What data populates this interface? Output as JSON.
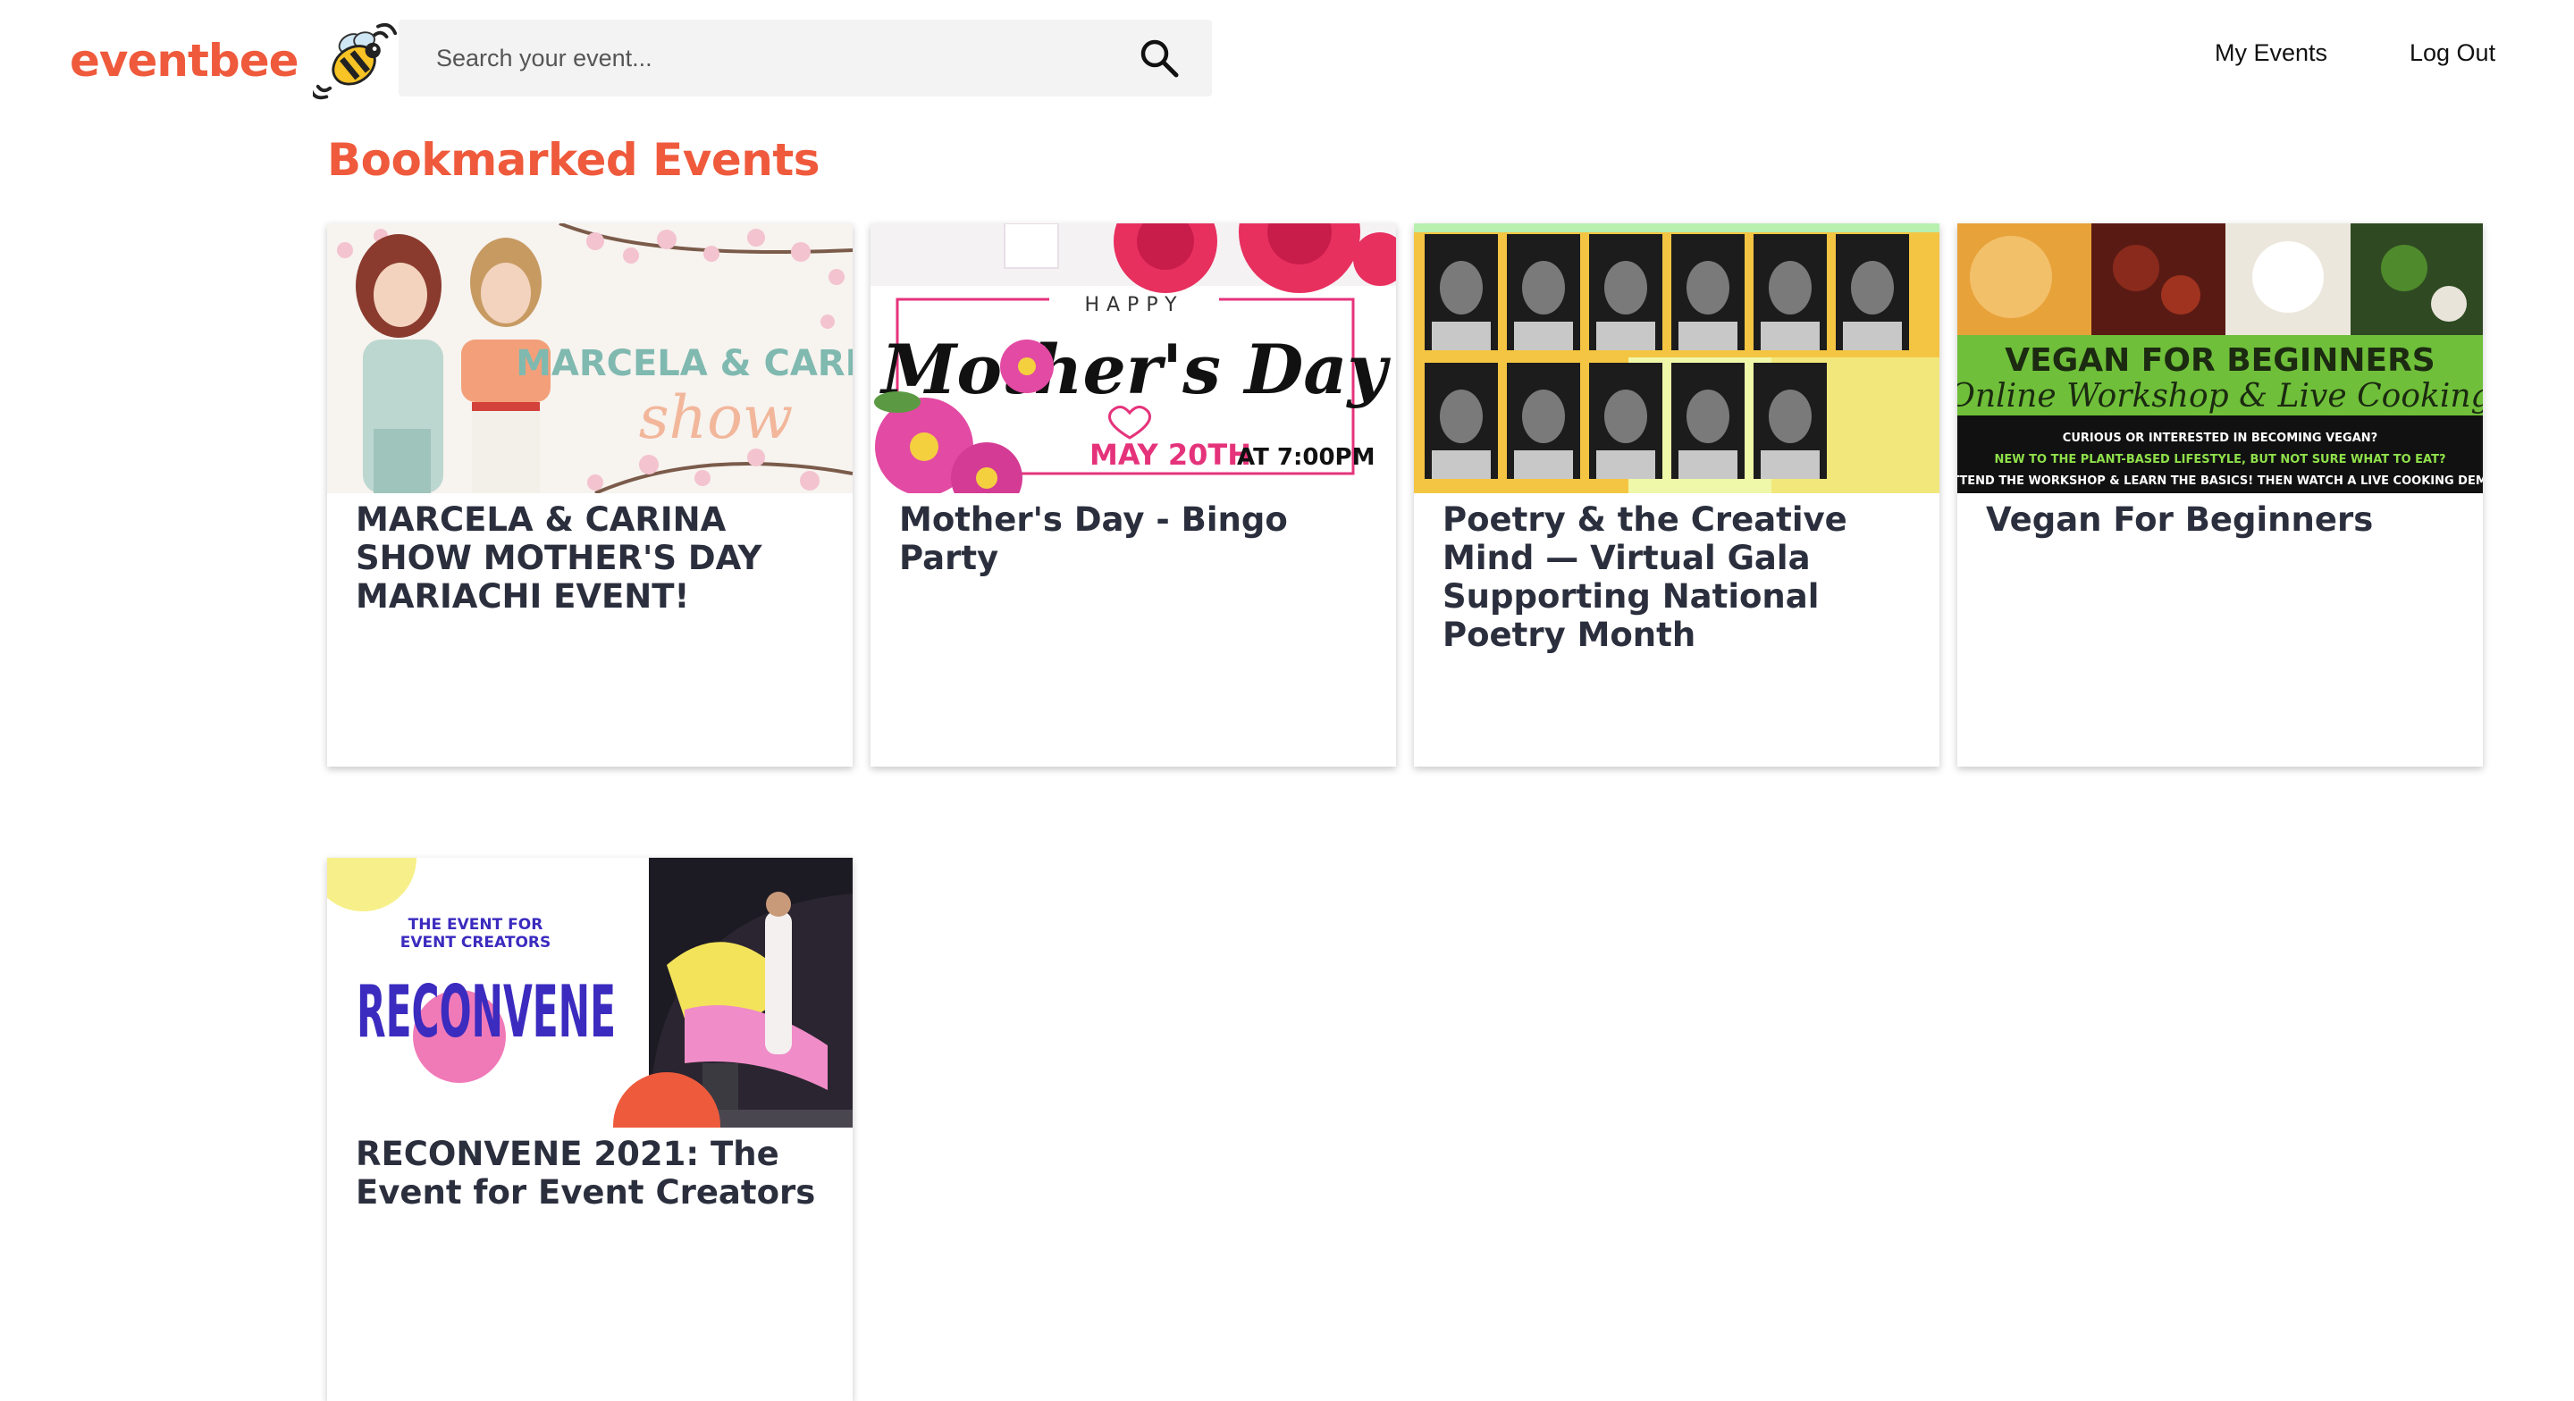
{
  "header": {
    "logo_text": "eventbee",
    "search": {
      "placeholder": "Search your event...",
      "value": ""
    },
    "nav": {
      "my_events": "My Events",
      "log_out": "Log Out"
    }
  },
  "section": {
    "title": "Bookmarked Events"
  },
  "events": [
    {
      "title": "MARCELA & CARINA SHOW MOTHER'S DAY MARIACHI EVENT!",
      "image_text": {
        "line1": "MARCELA & CARINA",
        "line2": "show"
      }
    },
    {
      "title": "Mother's Day - Bingo Party",
      "image_text": {
        "happy": "HAPPY",
        "script": "Mother's Day",
        "date": "MAY 20TH",
        "time": "AT 7:00PM"
      }
    },
    {
      "title": "Poetry & the Creative Mind — Virtual Gala Supporting National Poetry Month"
    },
    {
      "title": "Vegan For Beginners",
      "image_text": {
        "heading": "VEGAN FOR BEGINNERS",
        "script": "Online Workshop & Live Cooking",
        "line1": "CURIOUS OR INTERESTED IN BECOMING VEGAN?",
        "line2": "NEW TO THE PLANT-BASED LIFESTYLE, BUT NOT SURE WHAT TO EAT?",
        "line3": "ATTEND THE WORKSHOP & LEARN THE BASICS! THEN WATCH A LIVE COOKING DEMO"
      }
    },
    {
      "title": "RECONVENE 2021: The Event for Event Creators",
      "image_text": {
        "tag1": "THE EVENT FOR",
        "tag2": "EVENT CREATORS",
        "brand": "RECONVENE"
      }
    }
  ],
  "colors": {
    "brand": "#ef5a3c",
    "card_title": "#2b2f3d",
    "search_bg": "#f3f3f3"
  }
}
